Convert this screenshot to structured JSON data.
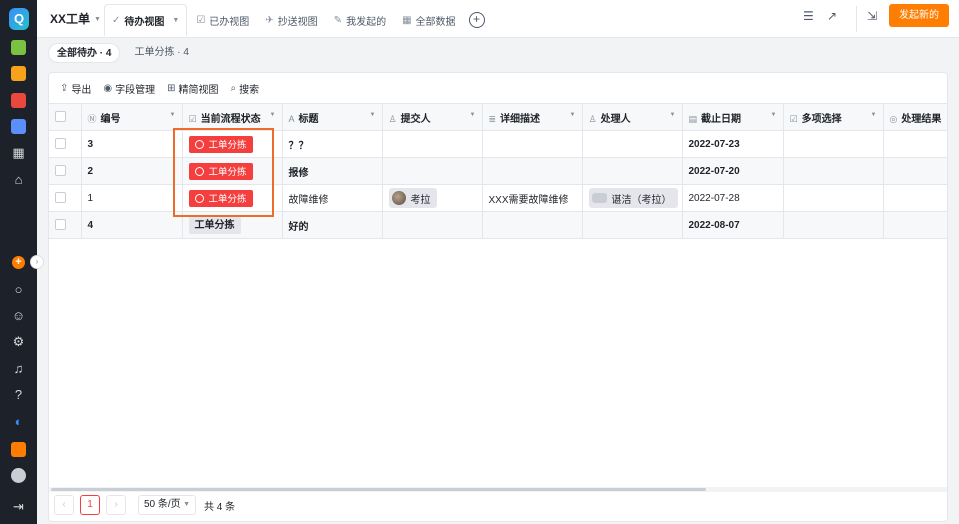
{
  "app": {
    "title": "XX工单",
    "logo_letter": "Q",
    "primary_action": "发起新的"
  },
  "tabs": [
    {
      "label": "待办视图",
      "icon": "✓",
      "active": true
    },
    {
      "label": "已办视图",
      "icon": "☑"
    },
    {
      "label": "抄送视图",
      "icon": "✈"
    },
    {
      "label": "我发起的",
      "icon": "✎"
    },
    {
      "label": "全部数据",
      "icon": "▦"
    }
  ],
  "filters": [
    {
      "label": "全部待办 · 4",
      "active": true
    },
    {
      "label": "工单分拣 · 4",
      "active": false
    }
  ],
  "toolbar": {
    "export": "导出",
    "fields": "字段管理",
    "compact": "精简视图",
    "search": "搜索"
  },
  "columns": [
    "编号",
    "当前流程状态",
    "标题",
    "提交人",
    "详细描述",
    "处理人",
    "截止日期",
    "多项选择",
    "处理结果"
  ],
  "rows": [
    {
      "id": "3",
      "status": "工单分拣",
      "title": "？？",
      "submitter": "",
      "desc": "",
      "handler": "",
      "deadline": "2022-07-23"
    },
    {
      "id": "2",
      "status": "工单分拣",
      "title": "报修",
      "submitter": "",
      "desc": "",
      "handler": "",
      "deadline": "2022-07-20"
    },
    {
      "id": "1",
      "status": "工单分拣",
      "title": "故障维修",
      "submitter": "考拉",
      "desc": "XXX需要故障维修",
      "handler": "谌洁（考拉）",
      "deadline": "2022-07-28"
    },
    {
      "id": "4",
      "status": "工单分拣",
      "title": "好的",
      "submitter": "",
      "desc": "",
      "handler": "",
      "deadline": "2022-08-07"
    }
  ],
  "pagination": {
    "page": "1",
    "page_size": "50 条/页",
    "total": "共 4 条"
  },
  "colors": {
    "accent": "#ff7d00",
    "status_red": "#f53f3f",
    "highlight": "#ee6b2a"
  }
}
